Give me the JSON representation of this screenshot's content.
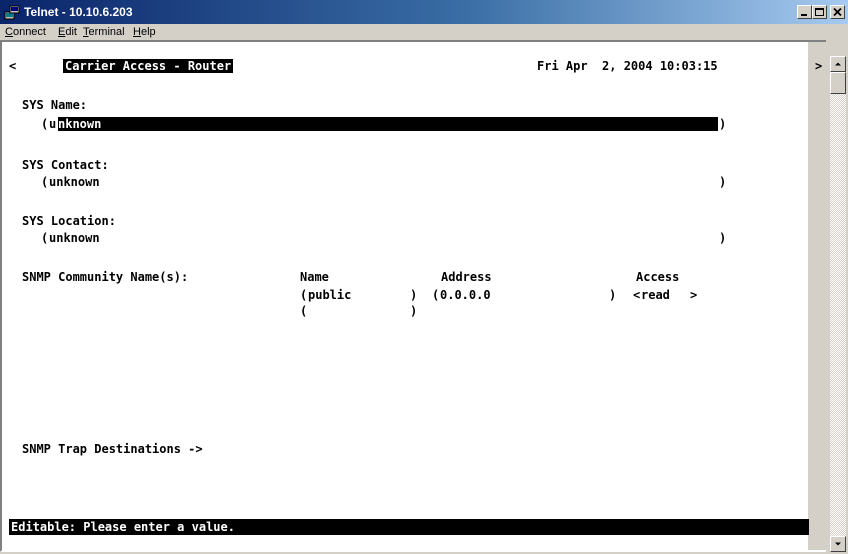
{
  "window": {
    "title": "Telnet - 10.10.6.203"
  },
  "menu": {
    "items": [
      "Connect",
      "Edit",
      "Terminal",
      "Help"
    ],
    "underline": [
      "C",
      "E",
      "T",
      "H"
    ]
  },
  "header": {
    "left_arrow": "<",
    "screen_title": "Carrier Access - Router",
    "datetime": "Fri Apr  2, 2004 10:03:15",
    "right_arrow": ">"
  },
  "fields": {
    "sys_name": {
      "label": "SYS Name:",
      "value": "unknown",
      "cursor_char": "u",
      "rest": "nknown"
    },
    "sys_contact": {
      "label": "SYS Contact:",
      "value": "unknown"
    },
    "sys_location": {
      "label": "SYS Location:",
      "value": "unknown"
    }
  },
  "snmp": {
    "label": "SNMP Community Name(s):",
    "columns": [
      "Name",
      "Address",
      "Access"
    ],
    "rows": [
      {
        "name": "public",
        "address": "0.0.0.0",
        "access": "read"
      },
      {
        "name": "",
        "address": "",
        "access": ""
      }
    ]
  },
  "trap": {
    "label": "SNMP Trap Destinations ->"
  },
  "status": {
    "message": "Editable: Please enter a value."
  },
  "colors": {
    "title_bar_start": "#0a246a",
    "title_bar_end": "#a6caf0",
    "highlight": "#000000",
    "background": "#ffffff"
  }
}
